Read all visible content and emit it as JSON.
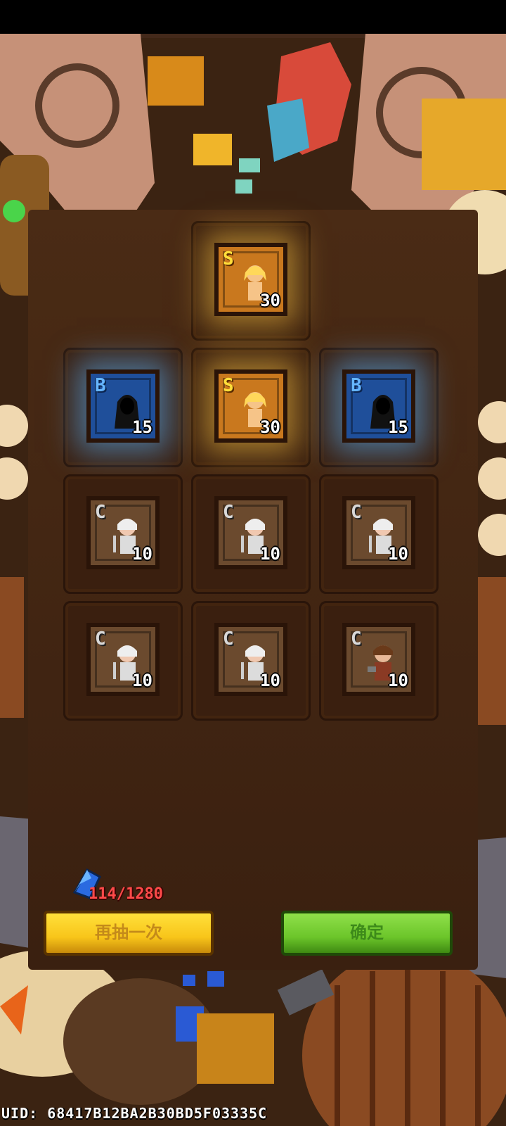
{
  "cards": [
    {
      "grade": "S",
      "count": "30",
      "hero": "blonde-warrior-portrait"
    },
    {
      "grade": "B",
      "count": "15",
      "hero": "hooded-shadow-portrait"
    },
    {
      "grade": "S",
      "count": "30",
      "hero": "blonde-warrior-portrait"
    },
    {
      "grade": "B",
      "count": "15",
      "hero": "hooded-shadow-portrait"
    },
    {
      "grade": "C",
      "count": "10",
      "hero": "white-hair-swordsman-portrait"
    },
    {
      "grade": "C",
      "count": "10",
      "hero": "white-hair-swordsman-portrait"
    },
    {
      "grade": "C",
      "count": "10",
      "hero": "white-hair-swordsman-portrait"
    },
    {
      "grade": "C",
      "count": "10",
      "hero": "white-hair-swordsman-portrait"
    },
    {
      "grade": "C",
      "count": "10",
      "hero": "white-hair-swordsman-portrait"
    },
    {
      "grade": "C",
      "count": "10",
      "hero": "brown-hair-fighter-portrait"
    }
  ],
  "currency": {
    "icon": "blue-crystal-icon",
    "amount": "114/1280",
    "color": "#ff4a4a"
  },
  "buttons": {
    "draw_again": "再抽一次",
    "confirm": "确定"
  },
  "footer": {
    "uid": "UID: 68417B12BA2B30BD5F03335C"
  },
  "colors": {
    "rarity_S": "#c9781e",
    "rarity_B": "#1f4f9a",
    "rarity_C": "#6b4a2e",
    "button_yellow": "#f8c51a",
    "button_green": "#6cc52a"
  }
}
